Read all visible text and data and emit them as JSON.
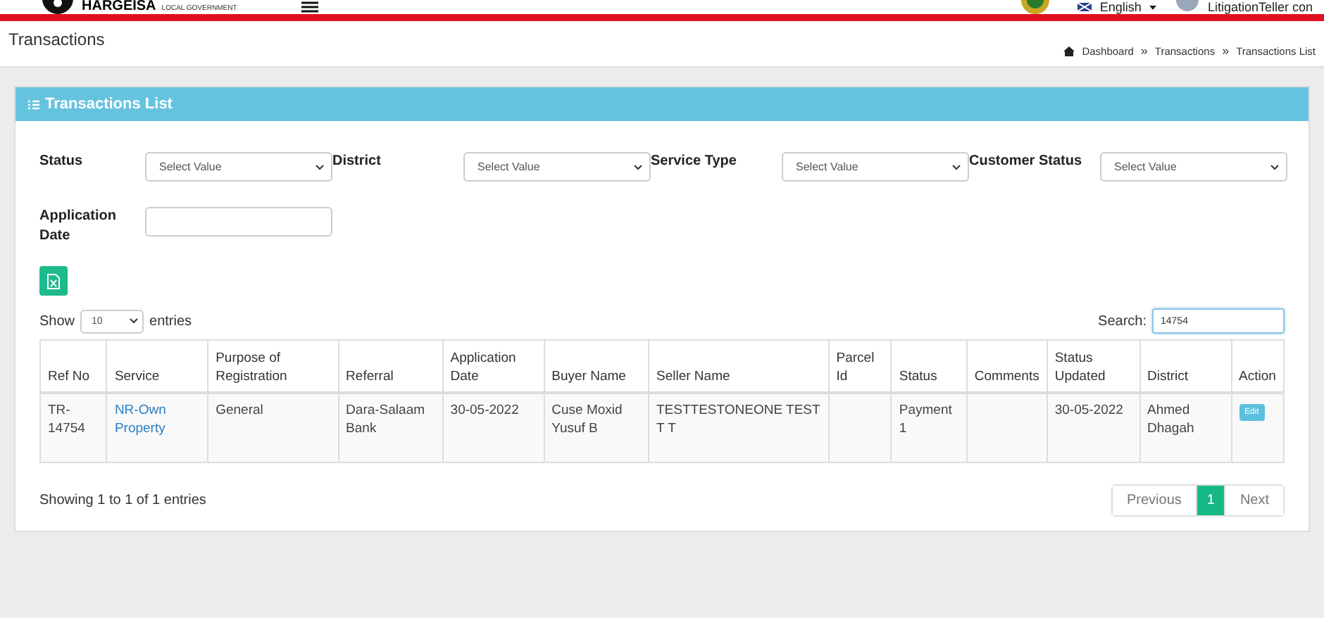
{
  "header": {
    "logo_title": "HARGEISA",
    "logo_subtitle": "LOCAL GOVERNMENT",
    "language": "English",
    "user": "LitigationTeller con"
  },
  "page_title": "Transactions",
  "breadcrumb": [
    "Dashboard",
    "Transactions",
    "Transactions List"
  ],
  "breadcrumb_separator": "»",
  "card": {
    "title": "Transactions List"
  },
  "filters": [
    {
      "label": "Status",
      "kind": "select",
      "placeholder": "Select Value"
    },
    {
      "label": "District",
      "kind": "select",
      "placeholder": "Select Value"
    },
    {
      "label": "Service Type",
      "kind": "select",
      "placeholder": "Select Value"
    },
    {
      "label": "Customer Status",
      "kind": "select",
      "placeholder": "Select Value"
    },
    {
      "label": "Application Date",
      "kind": "text"
    }
  ],
  "length": {
    "prefix": "Show",
    "value": "10",
    "suffix": "entries"
  },
  "search": {
    "label": "Search:",
    "value": "14754"
  },
  "table": {
    "columns": [
      "Ref No",
      "Service",
      "Purpose of Registration",
      "Referral",
      "Application Date",
      "Buyer Name",
      "Seller Name",
      "Parcel Id",
      "Status",
      "Comments",
      "Status Updated",
      "District",
      "Action"
    ],
    "rows": [
      {
        "cells": [
          "TR-14754",
          "NR-Own Property",
          "General",
          "Dara-Salaam Bank",
          "30-05-2022",
          "Cuse Moxid Yusuf B",
          "TESTTESTONEONE TEST T T",
          "",
          "Payment 1",
          "",
          "30-05-2022",
          "Ahmed Dhagah"
        ],
        "action": "Edit"
      }
    ]
  },
  "info": "Showing 1 to 1 of 1 entries",
  "pagination": [
    {
      "label": "Previous",
      "kind": "nav",
      "selected": false
    },
    {
      "label": "1",
      "kind": "page",
      "selected": true
    },
    {
      "label": "Next",
      "kind": "nav",
      "selected": false
    }
  ]
}
